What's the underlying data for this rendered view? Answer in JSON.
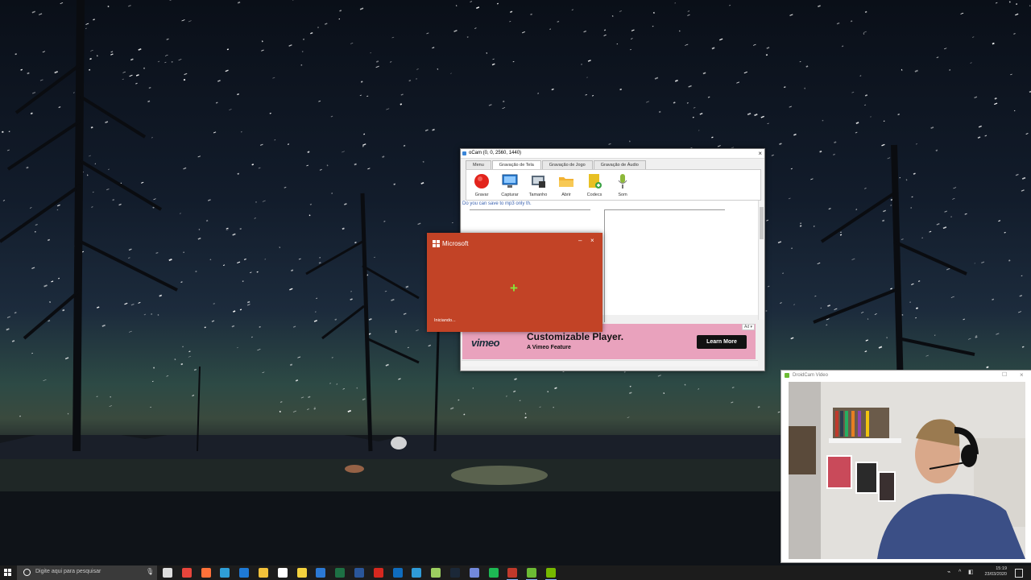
{
  "desktop": {
    "wallpaper": "starry-night-lake-trees"
  },
  "ocam": {
    "title": "oCam (0, 0, 2560, 1440)",
    "close_glyph": "×",
    "tabs": [
      {
        "label": "Menu"
      },
      {
        "label": "Gravação de Tela"
      },
      {
        "label": "Gravação de Jogo"
      },
      {
        "label": "Gravação de Áudio"
      }
    ],
    "tools": [
      {
        "label": "Gravar",
        "icon": "record-icon",
        "color": "#e2241c"
      },
      {
        "label": "Capturar",
        "icon": "monitor-icon",
        "color": "#2b7fd6"
      },
      {
        "label": "Tamanho",
        "icon": "resize-icon",
        "color": "#5b6a7a"
      },
      {
        "label": "Abrir",
        "icon": "folder-icon",
        "color": "#f2b233"
      },
      {
        "label": "Codecs",
        "icon": "codecs-icon",
        "color": "#e8c023"
      },
      {
        "label": "Som",
        "icon": "microphone-icon",
        "color": "#8db83a"
      }
    ],
    "message": "Do you can save to mp3 only th.",
    "ad": {
      "tag": "Ad ▾",
      "logo": "vimeo",
      "title": "Customizable Player.",
      "subtitle": "A Vimeo Feature",
      "button": "Learn More",
      "bg_color": "#e9a2bd"
    }
  },
  "splash": {
    "brand": "Microsoft",
    "minimize_glyph": "–",
    "close_glyph": "×",
    "spinner_glyph": "+",
    "status": "Iniciando...",
    "bg_color": "#c24326"
  },
  "droidcam": {
    "title": "DroidCam Video",
    "maximize_glyph": "☐",
    "close_glyph": "×"
  },
  "taskbar": {
    "search_placeholder": "Digite aqui para pesquisar",
    "mic_glyph": "🎙",
    "time": "15:19",
    "date": "23/03/2020",
    "apps": [
      {
        "name": "task-view-icon",
        "color": "#dddddd"
      },
      {
        "name": "chrome-icon",
        "color": "#e8453c"
      },
      {
        "name": "firefox-icon",
        "color": "#ff7139"
      },
      {
        "name": "edge-chromium-icon",
        "color": "#2f9fd8"
      },
      {
        "name": "edge-icon",
        "color": "#1e7ad6"
      },
      {
        "name": "file-explorer-icon",
        "color": "#f3c23a"
      },
      {
        "name": "store-icon",
        "color": "#ffffff"
      },
      {
        "name": "sticky-notes-icon",
        "color": "#f5d33e"
      },
      {
        "name": "mail-icon",
        "color": "#2b79d4"
      },
      {
        "name": "excel-icon",
        "color": "#1d7044"
      },
      {
        "name": "word-icon",
        "color": "#2a5699"
      },
      {
        "name": "acrobat-icon",
        "color": "#d7281f"
      },
      {
        "name": "outlook-icon",
        "color": "#0f6cbd"
      },
      {
        "name": "app-blue-icon",
        "color": "#2f9bd8"
      },
      {
        "name": "notepad-icon",
        "color": "#9ccf60"
      },
      {
        "name": "steam-icon",
        "color": "#1b2838"
      },
      {
        "name": "discord-icon",
        "color": "#7289da"
      },
      {
        "name": "spotify-icon",
        "color": "#1db954"
      },
      {
        "name": "ocam-icon",
        "color": "#c0392b"
      },
      {
        "name": "droidcam-icon",
        "color": "#6cbb34"
      },
      {
        "name": "nvidia-icon",
        "color": "#76b900"
      }
    ]
  }
}
